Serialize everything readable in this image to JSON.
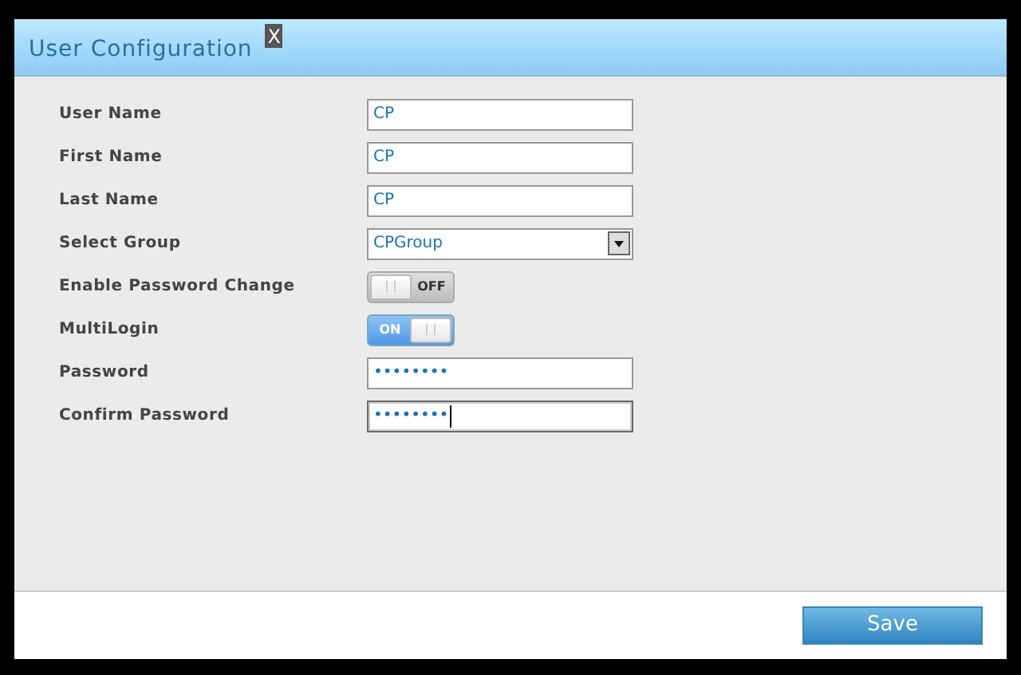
{
  "dialog": {
    "title": "User Configuration",
    "close": "X"
  },
  "fields": [
    {
      "kind": "text",
      "label": "User Name",
      "value": "CP"
    },
    {
      "kind": "text",
      "label": "First Name",
      "value": "CP"
    },
    {
      "kind": "text",
      "label": "Last Name",
      "value": "CP"
    },
    {
      "kind": "select",
      "label": "Select Group",
      "value": "CPGroup"
    },
    {
      "kind": "toggle",
      "label": "Enable Password Change",
      "on": false,
      "text": "OFF"
    },
    {
      "kind": "toggle",
      "label": "MultiLogin",
      "on": true,
      "text": "ON"
    },
    {
      "kind": "text",
      "label": "Password",
      "value": "••••••••",
      "focused": false
    },
    {
      "kind": "text",
      "label": "Confirm Password",
      "value": "••••••••",
      "focused": true
    }
  ],
  "buttons": [
    "Save"
  ]
}
